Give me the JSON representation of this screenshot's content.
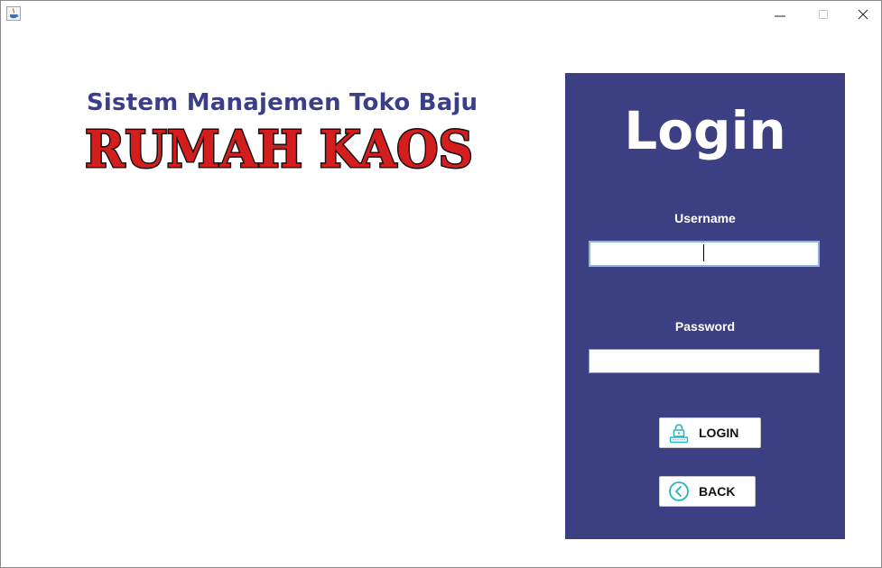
{
  "window": {
    "minimize_glyph": "—",
    "maximize_glyph": "☐",
    "close_glyph": "✕"
  },
  "brand": {
    "subtitle": "Sistem Manajemen Toko Baju",
    "logo_text": "RUMAH KAOS",
    "subtitle_color": "#3b3f88",
    "logo_fill": "#d41d1d"
  },
  "login": {
    "title": "Login",
    "panel_color": "#3d3f83",
    "username_label": "Username",
    "username_value": "",
    "password_label": "Password",
    "password_value": "",
    "login_button": "LOGIN",
    "back_button": "BACK",
    "login_icon": "lock-keyboard-icon",
    "back_icon": "chevron-left-circle-icon",
    "icon_color": "#26b5c3"
  }
}
